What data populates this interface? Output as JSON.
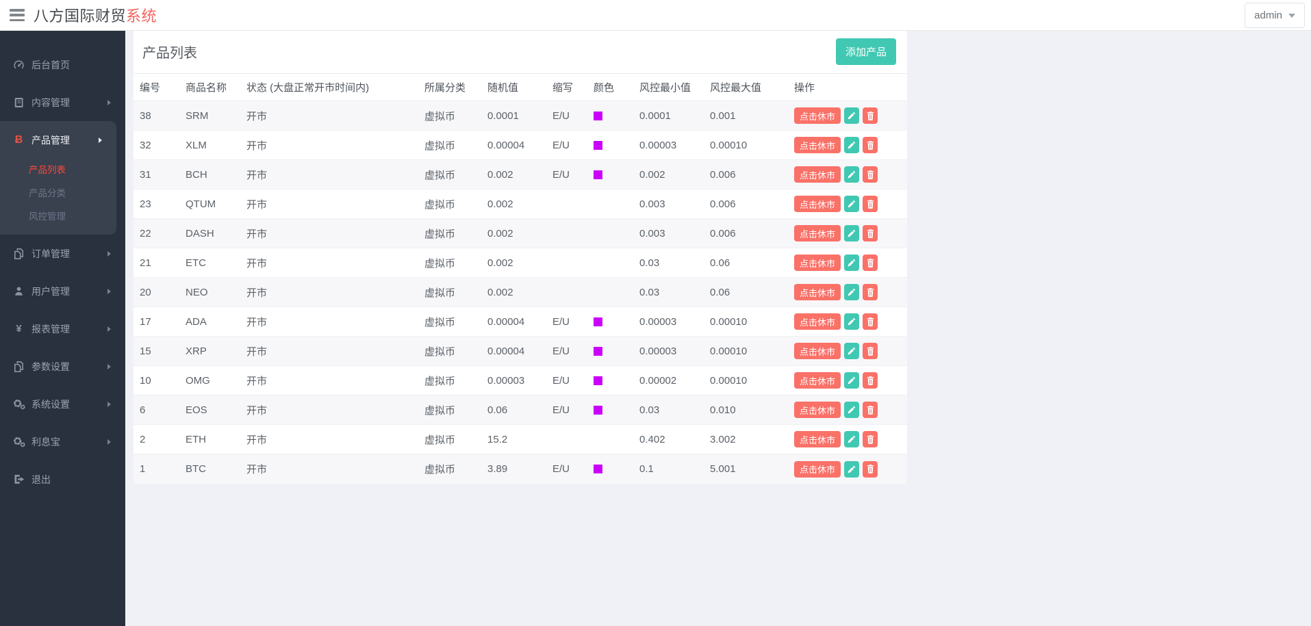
{
  "header": {
    "brand_primary": "八方国际财贸",
    "brand_accent": "系统",
    "user_menu_label": "admin"
  },
  "icons": {
    "bitcoin_glyph": "Ƀ",
    "yen_glyph": "¥"
  },
  "colors": {
    "teal_accent": "#41c8b2",
    "salmon_accent": "#fa7168",
    "brand_red": "#f0645f",
    "active_link_red": "#ff463c",
    "sidebar_bg": "#2a313e",
    "sidebar_active_bg": "#39414e",
    "swatch_magenta": "#cb00fa"
  },
  "sidebar": {
    "items": [
      {
        "label": "后台首页",
        "icon": "dashboard-icon",
        "has_children": false
      },
      {
        "label": "内容管理",
        "icon": "book-icon",
        "has_children": true
      },
      {
        "label": "产品管理",
        "icon": "bitcoin-icon",
        "has_children": true,
        "active": true,
        "children": [
          {
            "label": "产品列表",
            "active": true
          },
          {
            "label": "产品分类",
            "active": false
          },
          {
            "label": "风控管理",
            "active": false
          }
        ]
      },
      {
        "label": "订单管理",
        "icon": "copy-icon",
        "has_children": true
      },
      {
        "label": "用户管理",
        "icon": "user-icon",
        "has_children": true
      },
      {
        "label": "报表管理",
        "icon": "yen-icon",
        "has_children": true
      },
      {
        "label": "参数设置",
        "icon": "copy-icon",
        "has_children": true
      },
      {
        "label": "系统设置",
        "icon": "gears-icon",
        "has_children": true
      },
      {
        "label": "利息宝",
        "icon": "gears-icon",
        "has_children": true
      },
      {
        "label": "退出",
        "icon": "logout-icon",
        "has_children": false
      }
    ]
  },
  "main": {
    "card_title": "产品列表",
    "add_button": "添加产品",
    "table": {
      "columns": [
        "编号",
        "商品名称",
        "状态 (大盘正常开市时间内)",
        "所属分类",
        "随机值",
        "缩写",
        "颜色",
        "风控最小值",
        "风控最大值",
        "操作"
      ],
      "row_actions": {
        "suspend": "点击休市",
        "edit": "编辑",
        "delete": "删除"
      },
      "rows": [
        {
          "id": "38",
          "name": "SRM",
          "status": "开市",
          "category": "虚拟币",
          "random": "0.0001",
          "abbr": "E/U",
          "color": "#cb00fa",
          "risk_min": "0.0001",
          "risk_max": "0.001"
        },
        {
          "id": "32",
          "name": "XLM",
          "status": "开市",
          "category": "虚拟币",
          "random": "0.00004",
          "abbr": "E/U",
          "color": "#cb00fa",
          "risk_min": "0.00003",
          "risk_max": "0.00010"
        },
        {
          "id": "31",
          "name": "BCH",
          "status": "开市",
          "category": "虚拟币",
          "random": "0.002",
          "abbr": "E/U",
          "color": "#cb00fa",
          "risk_min": "0.002",
          "risk_max": "0.006"
        },
        {
          "id": "23",
          "name": "QTUM",
          "status": "开市",
          "category": "虚拟币",
          "random": "0.002",
          "abbr": "",
          "color": "",
          "risk_min": "0.003",
          "risk_max": "0.006"
        },
        {
          "id": "22",
          "name": "DASH",
          "status": "开市",
          "category": "虚拟币",
          "random": "0.002",
          "abbr": "",
          "color": "",
          "risk_min": "0.003",
          "risk_max": "0.006"
        },
        {
          "id": "21",
          "name": "ETC",
          "status": "开市",
          "category": "虚拟币",
          "random": "0.002",
          "abbr": "",
          "color": "",
          "risk_min": "0.03",
          "risk_max": "0.06"
        },
        {
          "id": "20",
          "name": "NEO",
          "status": "开市",
          "category": "虚拟币",
          "random": "0.002",
          "abbr": "",
          "color": "",
          "risk_min": "0.03",
          "risk_max": "0.06"
        },
        {
          "id": "17",
          "name": "ADA",
          "status": "开市",
          "category": "虚拟币",
          "random": "0.00004",
          "abbr": "E/U",
          "color": "#cb00fa",
          "risk_min": "0.00003",
          "risk_max": "0.00010"
        },
        {
          "id": "15",
          "name": "XRP",
          "status": "开市",
          "category": "虚拟币",
          "random": "0.00004",
          "abbr": "E/U",
          "color": "#cb00fa",
          "risk_min": "0.00003",
          "risk_max": "0.00010"
        },
        {
          "id": "10",
          "name": "OMG",
          "status": "开市",
          "category": "虚拟币",
          "random": "0.00003",
          "abbr": "E/U",
          "color": "#cb00fa",
          "risk_min": "0.00002",
          "risk_max": "0.00010"
        },
        {
          "id": "6",
          "name": "EOS",
          "status": "开市",
          "category": "虚拟币",
          "random": "0.06",
          "abbr": "E/U",
          "color": "#cb00fa",
          "risk_min": "0.03",
          "risk_max": "0.010"
        },
        {
          "id": "2",
          "name": "ETH",
          "status": "开市",
          "category": "虚拟币",
          "random": "15.2",
          "abbr": "",
          "color": "",
          "risk_min": "0.402",
          "risk_max": "3.002"
        },
        {
          "id": "1",
          "name": "BTC",
          "status": "开市",
          "category": "虚拟币",
          "random": "3.89",
          "abbr": "E/U",
          "color": "#cb00fa",
          "risk_min": "0.1",
          "risk_max": "5.001"
        }
      ]
    }
  }
}
